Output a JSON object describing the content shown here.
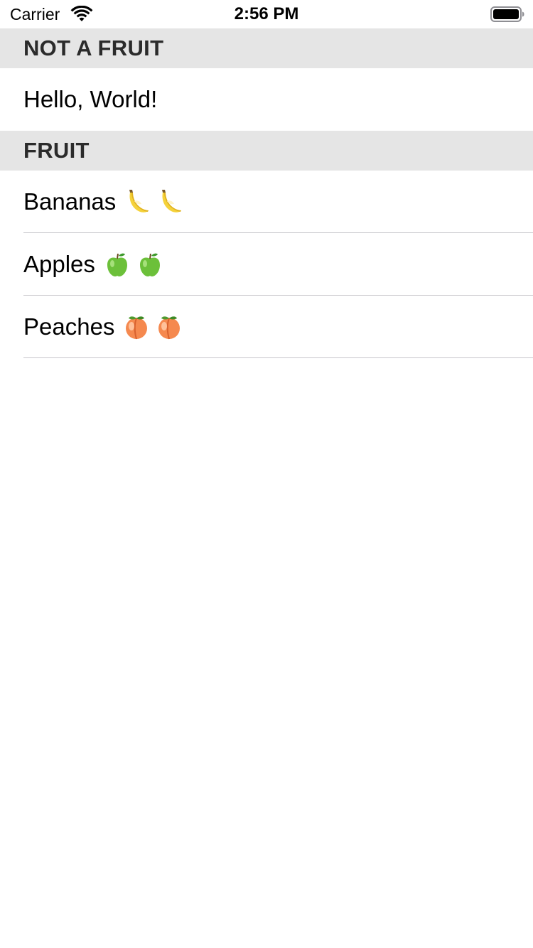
{
  "status_bar": {
    "carrier": "Carrier",
    "time": "2:56 PM",
    "wifi_icon": "wifi-icon",
    "battery_icon": "battery-icon"
  },
  "sections": [
    {
      "header": "NOT A FRUIT",
      "rows": [
        {
          "label": "Hello, World!",
          "emojis": []
        }
      ]
    },
    {
      "header": "FRUIT",
      "rows": [
        {
          "label": "Bananas",
          "emojis": [
            "banana-icon",
            "banana-icon"
          ]
        },
        {
          "label": "Apples",
          "emojis": [
            "green-apple-icon",
            "green-apple-icon"
          ]
        },
        {
          "label": "Peaches",
          "emojis": [
            "peach-icon",
            "peach-icon"
          ]
        }
      ]
    }
  ],
  "colors": {
    "section_header_bg": "#e5e5e5",
    "separator": "#c8c7cc",
    "banana": "#f5d23a",
    "apple": "#6cc03a",
    "peach": "#f5894f"
  }
}
